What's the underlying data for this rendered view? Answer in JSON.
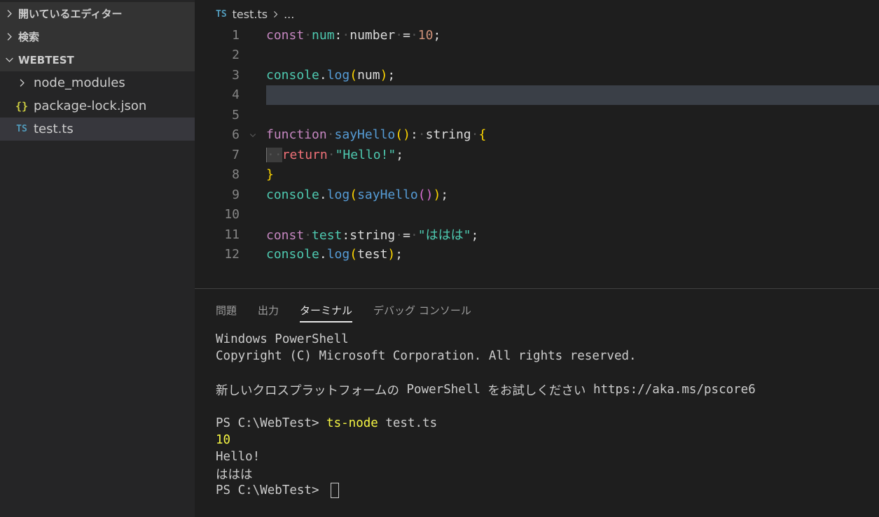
{
  "sidebar": {
    "open_editors_label": "開いているエディター",
    "search_label": "検索",
    "workspace_label": "WEBTEST",
    "items": [
      {
        "label": "node_modules",
        "icon": "chevron-right-icon"
      },
      {
        "label": "package-lock.json",
        "icon_text": "{}"
      },
      {
        "label": "test.ts",
        "icon_text": "TS"
      }
    ]
  },
  "editor": {
    "breadcrumb": {
      "file_icon": "TS",
      "file": "test.ts",
      "more": "..."
    },
    "lines": [
      {
        "n": "1"
      },
      {
        "n": "2"
      },
      {
        "n": "3"
      },
      {
        "n": "4"
      },
      {
        "n": "5"
      },
      {
        "n": "6"
      },
      {
        "n": "7"
      },
      {
        "n": "8"
      },
      {
        "n": "9"
      },
      {
        "n": "10"
      },
      {
        "n": "11"
      },
      {
        "n": "12"
      }
    ],
    "code": {
      "l1": {
        "kw": "const",
        "name": "num",
        "colon": ":",
        "type": "number",
        "eq": "=",
        "value": "10",
        "semi": ";"
      },
      "l3": {
        "obj": "console",
        "dot": ".",
        "fn": "log",
        "open": "(",
        "arg": "num",
        "close": ")",
        "semi": ";"
      },
      "l6": {
        "kw": "function",
        "fn": "sayHello",
        "parens": "()",
        "colon": ":",
        "type": "string",
        "brace": "{"
      },
      "l7": {
        "kw": "return",
        "value": "\"Hello!\"",
        "semi": ";"
      },
      "l8": {
        "brace": "}"
      },
      "l9": {
        "obj": "console",
        "dot": ".",
        "fn": "log",
        "open": "(",
        "arg": "sayHello",
        "inner": "()",
        "close": ")",
        "semi": ";"
      },
      "l11": {
        "kw": "const",
        "name": "test",
        "colon": ":",
        "type": "string",
        "eq": "=",
        "value": "\"ははは\"",
        "semi": ";"
      },
      "l12": {
        "obj": "console",
        "dot": ".",
        "fn": "log",
        "open": "(",
        "arg": "test",
        "close": ")",
        "semi": ";"
      }
    }
  },
  "panel": {
    "tabs": [
      "問題",
      "出力",
      "ターミナル",
      "デバッグ コンソール"
    ],
    "active_tab": "ターミナル",
    "terminal": {
      "l1": "Windows PowerShell",
      "l2": "Copyright (C) Microsoft Corporation. All rights reserved.",
      "l3_a": "新しいクロスプラットフォームの ",
      "l3_b": "PowerShell",
      "l3_c": " をお試しください ",
      "l3_d": "https://aka.ms/pscore6",
      "prompt": "PS C:\\WebTest> ",
      "cmd": "ts-node",
      "cmd_arg": " test.ts",
      "out1": "10",
      "out2": "Hello!",
      "out3": "ははは",
      "prompt2": "PS C:\\WebTest> "
    }
  }
}
